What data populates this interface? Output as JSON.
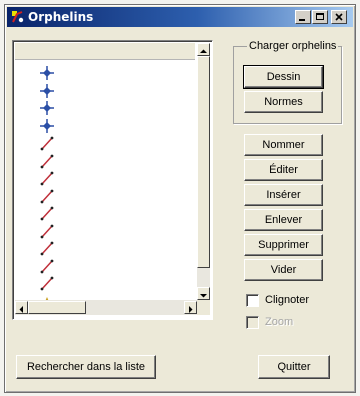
{
  "window": {
    "title": "Orphelins",
    "controls": [
      "minimize-icon",
      "maximize-icon",
      "close-icon"
    ]
  },
  "list": {
    "items": [
      {
        "type": "point",
        "icon": "blue-point-icon"
      },
      {
        "type": "point",
        "icon": "blue-point-icon"
      },
      {
        "type": "point",
        "icon": "blue-point-icon"
      },
      {
        "type": "point",
        "icon": "blue-point-icon"
      },
      {
        "type": "line",
        "icon": "red-line-icon"
      },
      {
        "type": "line",
        "icon": "red-line-icon"
      },
      {
        "type": "line",
        "icon": "red-line-icon"
      },
      {
        "type": "line",
        "icon": "red-line-icon"
      },
      {
        "type": "line",
        "icon": "red-line-icon"
      },
      {
        "type": "line",
        "icon": "red-line-icon"
      },
      {
        "type": "line",
        "icon": "red-line-icon"
      },
      {
        "type": "line",
        "icon": "red-line-icon"
      },
      {
        "type": "line",
        "icon": "red-line-icon"
      },
      {
        "type": "text",
        "icon": "text-marker-icon"
      }
    ]
  },
  "load_group": {
    "legend": "Charger orphelins",
    "dessin": "Dessin",
    "normes": "Normes"
  },
  "actions": {
    "nommer": "Nommer",
    "editer": "Éditer",
    "inserer": "Insérer",
    "enlever": "Enlever",
    "supprimer": "Supprimer",
    "vider": "Vider"
  },
  "options": {
    "clignoter": "Clignoter",
    "zoom": "Zoom"
  },
  "footer": {
    "search": "Rechercher dans la liste",
    "quit": "Quitter"
  },
  "colors": {
    "point": "#2b4fa6",
    "line": "#c0303a",
    "text_marker": "#c9a020"
  }
}
